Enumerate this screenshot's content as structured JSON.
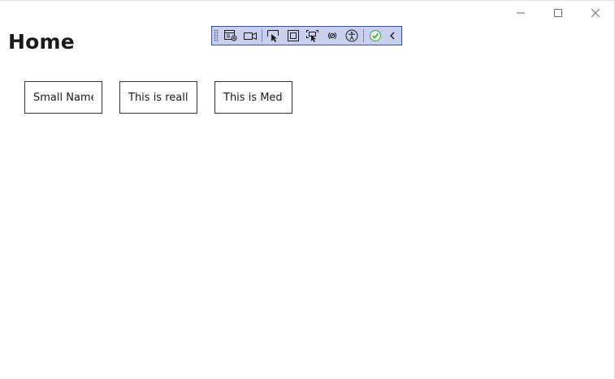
{
  "page": {
    "title": "Home"
  },
  "window_controls": [
    "minimize-icon",
    "maximize-icon",
    "close-icon"
  ],
  "debug_toolbar": {
    "tools": [
      "live-visual-tree-icon",
      "video-camera-icon",
      "select-element-icon",
      "display-layout-adorners-icon",
      "track-focus-icon",
      "binding-failures-icon",
      "accessibility-icon",
      "check-accessibility-icon",
      "collapse-chevron-icon"
    ],
    "colors": {
      "background": "#c8d0ee",
      "border": "#3b4f9a",
      "check": "#3aa64a"
    }
  },
  "buttons": [
    {
      "label": "Small Name"
    },
    {
      "label": "This is really"
    },
    {
      "label": "This is Mediu"
    }
  ]
}
